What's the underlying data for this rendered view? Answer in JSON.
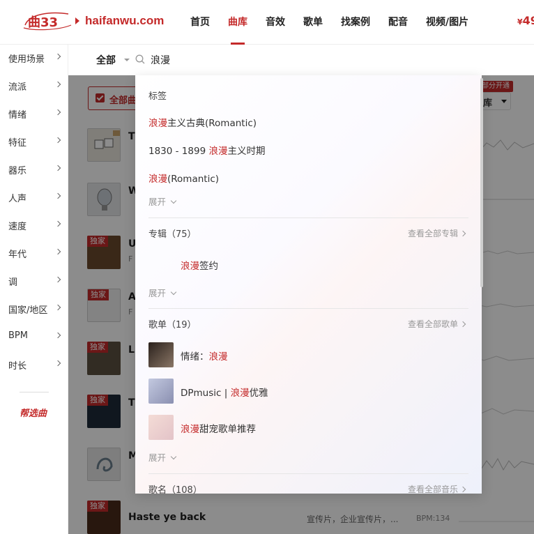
{
  "header": {
    "logo_text": "曲33",
    "domain": "haifanwu.com",
    "nav": [
      "首页",
      "曲库",
      "音效",
      "歌单",
      "找案例",
      "配音",
      "视频/图片"
    ],
    "active_nav": "曲库",
    "price_prefix": "¥",
    "price_value": "49"
  },
  "sidebar": {
    "items": [
      "使用场景",
      "流派",
      "情绪",
      "特征",
      "器乐",
      "人声",
      "速度",
      "年代",
      "调",
      "国家/地区",
      "BPM",
      "时长"
    ],
    "help": "帮选曲"
  },
  "search": {
    "scope": "全部",
    "query": "浪漫"
  },
  "content": {
    "filter_label": "全部曲",
    "vip_tag": "部分开通",
    "lib_label": "库",
    "exclusive_label": "独家",
    "rows": [
      {
        "initial": "T",
        "sub": "",
        "exclusive": false
      },
      {
        "initial": "W",
        "sub": "",
        "exclusive": false
      },
      {
        "initial": "U",
        "sub": "F",
        "exclusive": true
      },
      {
        "initial": "A",
        "sub": "F",
        "exclusive": true
      },
      {
        "initial": "L",
        "sub": "",
        "exclusive": true
      },
      {
        "initial": "T",
        "sub": "",
        "exclusive": true
      },
      {
        "initial": "M",
        "sub": "",
        "exclusive": false
      }
    ],
    "last_row": {
      "title": "Haste ye back",
      "tags": "宣传片，企业宣传片，...",
      "bpm": "BPM:134"
    }
  },
  "dropdown": {
    "tags_section": {
      "title": "标签",
      "items": [
        {
          "pre": "",
          "hl": "浪漫",
          "post": "主义古典(Romantic)"
        },
        {
          "pre": "1830 - 1899 ",
          "hl": "浪漫",
          "post": "主义时期"
        },
        {
          "pre": "",
          "hl": "浪漫",
          "post": "(Romantic)"
        }
      ],
      "expand": "展开"
    },
    "album_section": {
      "title": "专辑（75）",
      "link": "查看全部专辑",
      "items": [
        {
          "hl": "浪漫",
          "post": "签约"
        }
      ],
      "expand": "展开"
    },
    "playlist_section": {
      "title": "歌单（19）",
      "link": "查看全部歌单",
      "items": [
        {
          "pre": "情绪：",
          "hl": "浪漫",
          "post": ""
        },
        {
          "pre": "DPmusic | ",
          "hl": "浪漫",
          "post": "优雅"
        },
        {
          "pre": "",
          "hl": "浪漫",
          "post": "甜宠歌单推荐"
        }
      ],
      "expand": "展开"
    },
    "song_section": {
      "title": "歌名（108）",
      "link": "查看全部音乐"
    }
  }
}
